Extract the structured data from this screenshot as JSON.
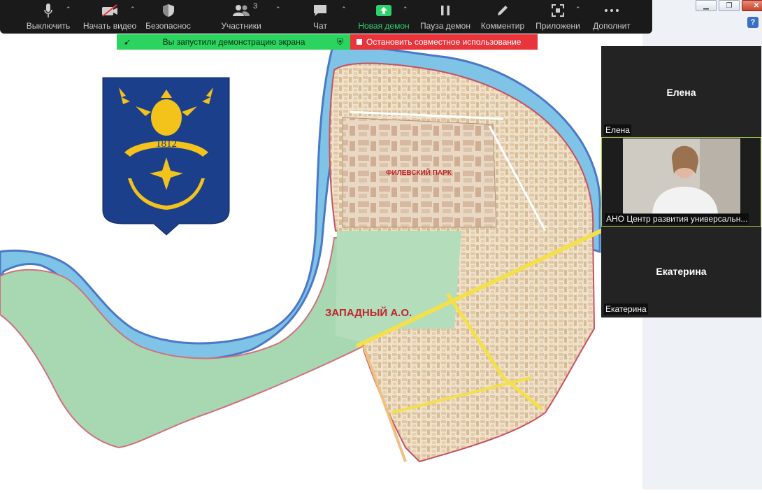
{
  "toolbar": {
    "items": [
      {
        "label": "Выключить",
        "icon": "microphone-icon"
      },
      {
        "label": "Начать видео",
        "icon": "video-off-icon"
      },
      {
        "label": "Безопаснос",
        "icon": "shield-icon"
      },
      {
        "label": "Участники",
        "icon": "participants-icon",
        "count": "3"
      },
      {
        "label": "Чат",
        "icon": "chat-icon"
      },
      {
        "label": "Новая демон",
        "icon": "share-screen-icon",
        "active": true
      },
      {
        "label": "Пауза демон",
        "icon": "pause-icon"
      },
      {
        "label": "Комментир",
        "icon": "pencil-icon"
      },
      {
        "label": "Приложени",
        "icon": "apps-icon"
      },
      {
        "label": "Дополнит",
        "icon": "more-icon"
      }
    ],
    "accent": "#2fd16c"
  },
  "share_banner": {
    "status_text": "Вы запустили демонстрацию экрана",
    "stop_text": "Остановить совместное использование",
    "green": "#2bd35f",
    "red": "#e8343a"
  },
  "map": {
    "emblem_year": "1812",
    "labels": {
      "park": "ФИЛЕВСКИЙ ПАРК",
      "district": "ЗАПАДНЫЙ А.О."
    }
  },
  "participants": [
    {
      "name": "Елена",
      "tile_name": "Елена",
      "video": false
    },
    {
      "name": "АНО Центр развития универсальн...",
      "video": true
    },
    {
      "name": "Екатерина",
      "tile_name": "Екатерина",
      "video": false
    }
  ]
}
